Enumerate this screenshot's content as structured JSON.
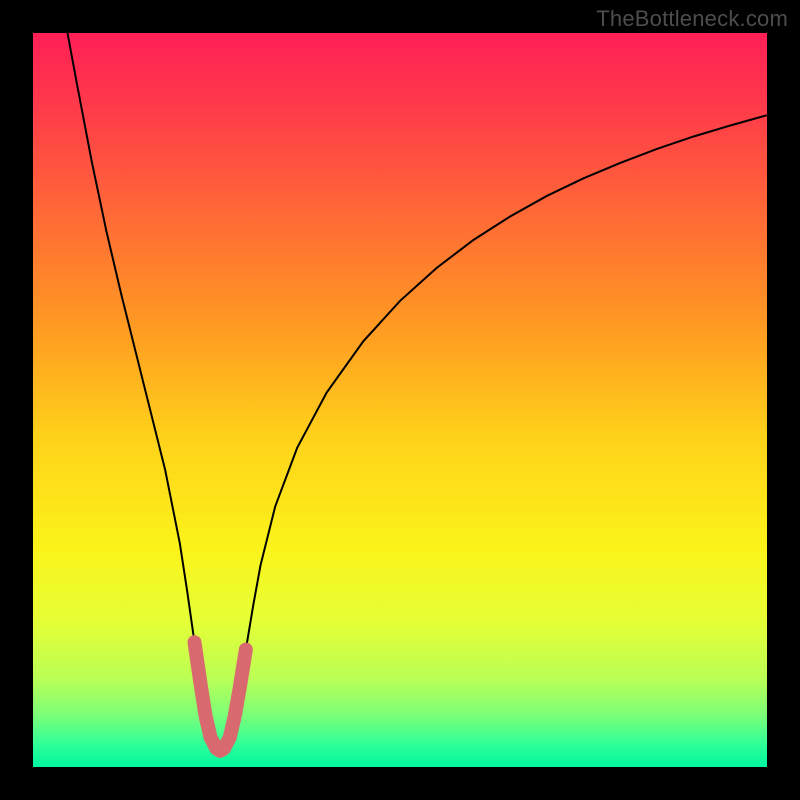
{
  "watermark": "TheBottleneck.com",
  "chart_data": {
    "type": "line",
    "title": "",
    "xlabel": "",
    "ylabel": "",
    "xlim": [
      0,
      100
    ],
    "ylim": [
      0,
      100
    ],
    "grid": false,
    "gradient_stops": [
      {
        "offset": 0.0,
        "color": "#ff1f57"
      },
      {
        "offset": 0.1,
        "color": "#ff3a4a"
      },
      {
        "offset": 0.25,
        "color": "#ff6a36"
      },
      {
        "offset": 0.4,
        "color": "#ff9a22"
      },
      {
        "offset": 0.55,
        "color": "#ffd11a"
      },
      {
        "offset": 0.7,
        "color": "#fbf31a"
      },
      {
        "offset": 0.8,
        "color": "#e6ff35"
      },
      {
        "offset": 0.88,
        "color": "#baff55"
      },
      {
        "offset": 0.93,
        "color": "#7bff79"
      },
      {
        "offset": 0.97,
        "color": "#2dff98"
      },
      {
        "offset": 1.0,
        "color": "#00f7a0"
      }
    ],
    "series": [
      {
        "name": "bottleneck-curve",
        "stroke": "#000000",
        "stroke_width": 2.0,
        "x": [
          4.7,
          6.0,
          8.0,
          10.0,
          12.0,
          14.0,
          16.0,
          18.0,
          20.0,
          21.0,
          22.0,
          23.0,
          24.0,
          25.0,
          25.5,
          26.0,
          27.0,
          28.0,
          29.0,
          30.0,
          31.0,
          33.0,
          36.0,
          40.0,
          45.0,
          50.0,
          55.0,
          60.0,
          65.0,
          70.0,
          75.0,
          80.0,
          85.0,
          90.0,
          95.0,
          100.0
        ],
        "y": [
          100.0,
          93.0,
          82.5,
          73.0,
          64.5,
          56.5,
          48.5,
          40.5,
          30.5,
          24.0,
          17.0,
          10.0,
          5.0,
          2.5,
          2.2,
          2.5,
          5.0,
          10.0,
          16.0,
          22.0,
          27.5,
          35.5,
          43.5,
          51.0,
          58.0,
          63.5,
          68.0,
          71.8,
          75.0,
          77.8,
          80.2,
          82.3,
          84.2,
          85.9,
          87.4,
          88.8
        ]
      },
      {
        "name": "optimal-zone-marker",
        "stroke": "#d86a6f",
        "stroke_width": 14,
        "linecap": "round",
        "x": [
          22.0,
          22.8,
          23.5,
          24.2,
          25.0,
          25.5,
          26.0,
          26.8,
          27.5,
          28.2,
          29.0
        ],
        "y": [
          17.0,
          11.5,
          7.0,
          4.0,
          2.5,
          2.2,
          2.5,
          4.0,
          7.0,
          11.0,
          16.0
        ]
      }
    ]
  }
}
